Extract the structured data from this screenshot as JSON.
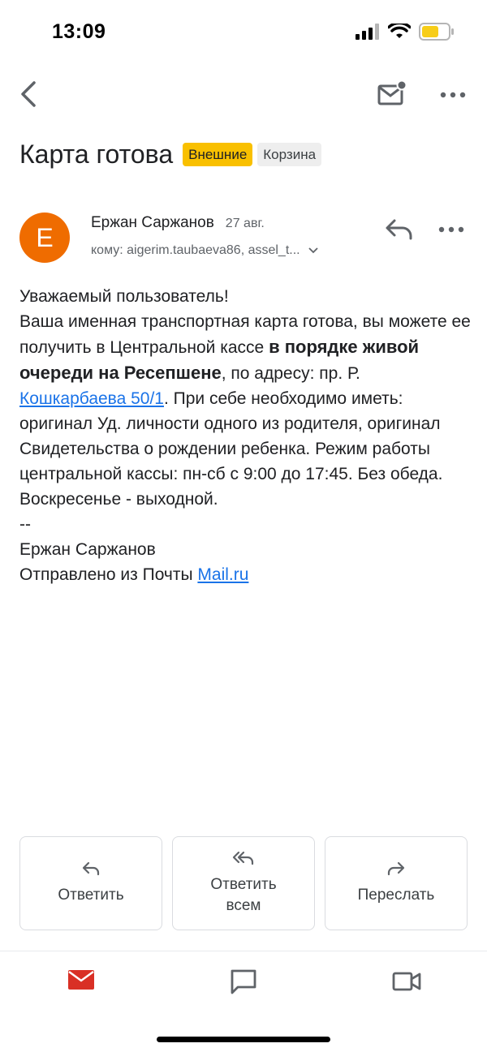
{
  "status_bar": {
    "time": "13:09"
  },
  "email": {
    "subject": "Карта готова",
    "labels": [
      "Внешние",
      "Корзина"
    ],
    "sender": {
      "name": "Ержан Саржанов",
      "initial": "E",
      "date": "27 авг.",
      "to": "кому: aigerim.taubaeva86, assel_t..."
    },
    "body": {
      "greeting": "Уважаемый пользователь!",
      "p1_start": "Ваша именная транспортная карта готова, вы можете ее получить в Центральной кассе ",
      "p1_bold": "в порядке живой очереди на Ресепшене",
      "p1_mid": ", по адресу: пр. Р. ",
      "p1_link": "Кошкарбаева 50/1",
      "p1_end": ". При себе необходимо иметь: оригинал Уд. личности одного из родителя, оригинал Свидетельства о рождении ребенка. Режим работы центральной кассы: пн-сб с 9:00 до 17:45. Без обеда. Воскресенье - выходной.",
      "sig_dashes": "--",
      "sig_name": "Ержан Саржанов",
      "sig_sent": "Отправлено из Почты ",
      "sig_link": "Mail.ru"
    }
  },
  "actions": {
    "reply": "Ответить",
    "reply_all": "Ответить всем",
    "forward": "Переслать"
  },
  "colors": {
    "avatar": "#ef6c00",
    "chip_external": "#f9c000",
    "link": "#1a73e8",
    "mail_nav_active": "#d93025"
  },
  "icons": [
    "back-arrow-icon",
    "mark-unread-icon",
    "more-vert-icon",
    "reply-icon",
    "reply-all-icon",
    "forward-icon",
    "mail-icon",
    "chat-icon",
    "video-icon"
  ]
}
